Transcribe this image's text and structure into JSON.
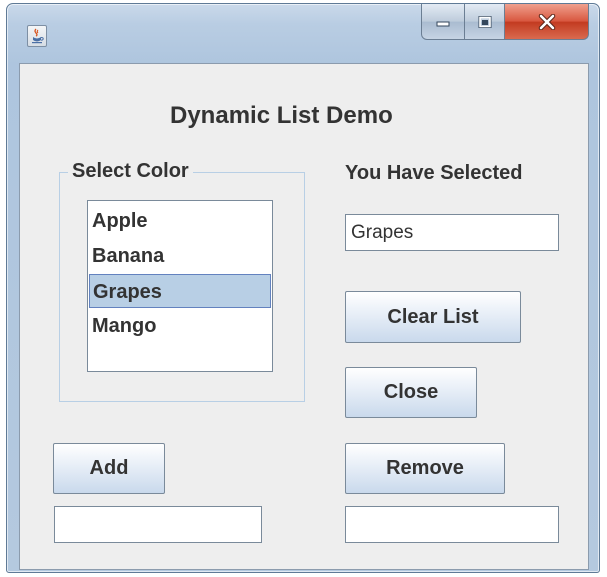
{
  "window": {
    "icon": "java-cup-icon",
    "buttons": {
      "minimize": "minimize-icon",
      "maximize": "maximize-icon",
      "close": "close-icon"
    }
  },
  "heading": "Dynamic List Demo",
  "group": {
    "legend": "Select Color",
    "items": [
      "Apple",
      "Banana",
      "Grapes",
      "Mango"
    ],
    "selected_index": 2
  },
  "selected_label": "You Have Selected",
  "selected_value": "Grapes",
  "buttons": {
    "clear": "Clear List",
    "close": "Close",
    "add": "Add",
    "remove": "Remove"
  },
  "fields": {
    "add_value": "",
    "remove_value": ""
  },
  "colors": {
    "selection": "#b8cfe5",
    "window_frame": "#aec5de",
    "close_button": "#c23a20"
  }
}
